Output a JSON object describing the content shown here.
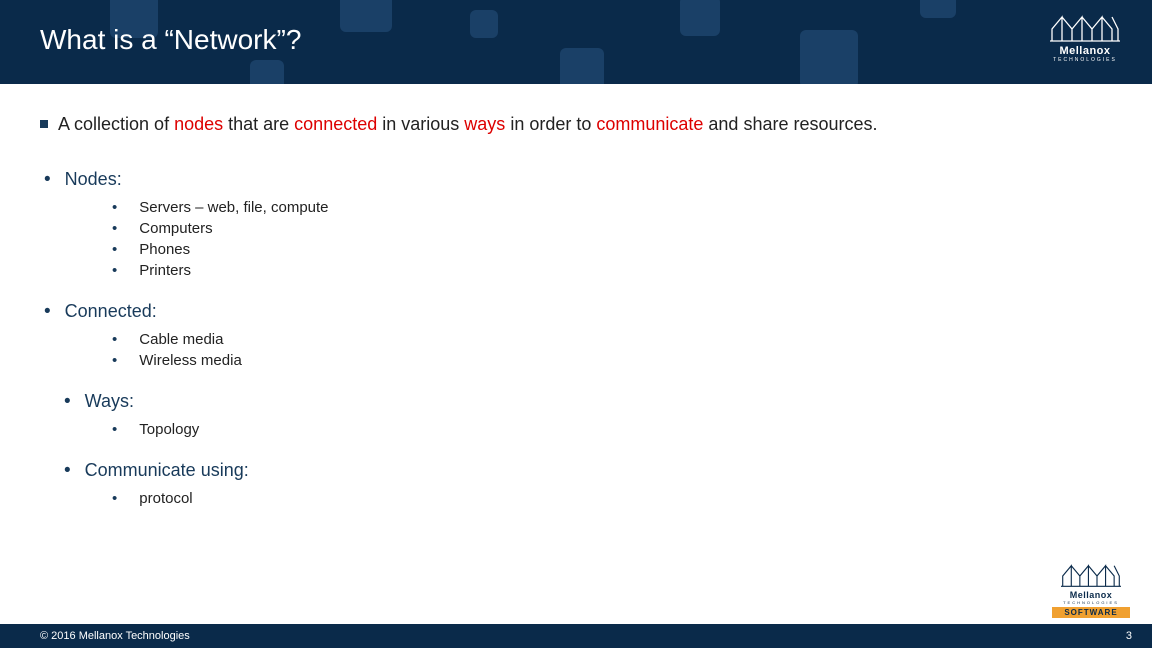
{
  "title": "What is a “Network”?",
  "definition": {
    "p1": "A collection of ",
    "hl1": "nodes",
    "p2": " that are ",
    "hl2": "connected",
    "p3": " in various ",
    "hl3": "ways",
    "p4": " in order to ",
    "hl4": "communicate",
    "p5": " and share resources."
  },
  "sections": {
    "nodes": {
      "label": "Nodes:",
      "items": [
        "Servers – web, file, compute",
        "Computers",
        "Phones",
        "Printers"
      ]
    },
    "connected": {
      "label": "Connected:",
      "items": [
        "Cable media",
        "Wireless media"
      ]
    },
    "ways": {
      "label": "Ways:",
      "items": [
        "Topology"
      ]
    },
    "communicate": {
      "label": "Communicate using:",
      "items": [
        "protocol"
      ]
    }
  },
  "brand": {
    "name": "Mellanox",
    "sub": "TECHNOLOGIES",
    "software": "SOFTWARE"
  },
  "footer": {
    "copyright": "© 2016 Mellanox Technologies",
    "page": "3"
  }
}
